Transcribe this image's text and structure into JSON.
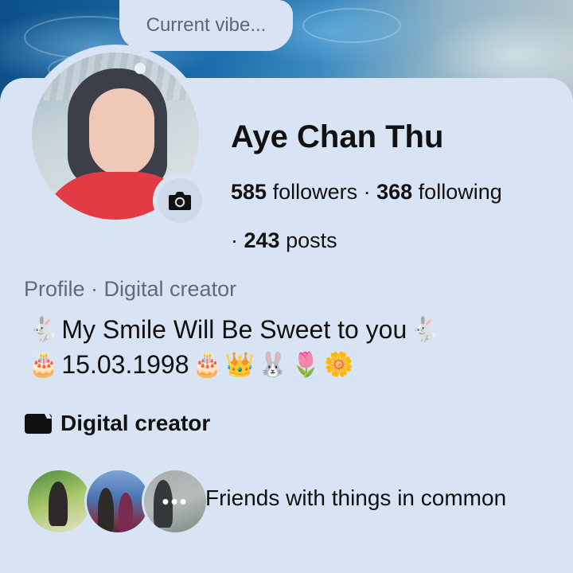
{
  "profile": {
    "note": "Current vibe...",
    "name": "Aye Chan Thu",
    "followers_count": "585",
    "followers_label": " followers · ",
    "following_count": "368",
    "following_label": " following",
    "posts_prefix": "· ",
    "posts_count": "243",
    "posts_label": " posts",
    "category_line": "Profile · Digital creator"
  },
  "bio": {
    "line1_lead_emoji": "🐇",
    "line1_text": "My Smile Will Be Sweet to you",
    "line1_trail_emoji": "🐇",
    "line2_lead_emoji": "🎂",
    "line2_text": "15.03.1998",
    "line2_emojis": [
      "🎂",
      "👑",
      "🐰",
      "🌷",
      "🌼"
    ]
  },
  "detail": {
    "icon": "clapperboard-icon",
    "label": "Digital creator"
  },
  "mutual": {
    "label": "Friends with things in common",
    "more_label": "•••"
  },
  "colors": {
    "background": "#d8e4f4",
    "secondary_text": "#5f6b7c",
    "primary_text": "#111111"
  }
}
